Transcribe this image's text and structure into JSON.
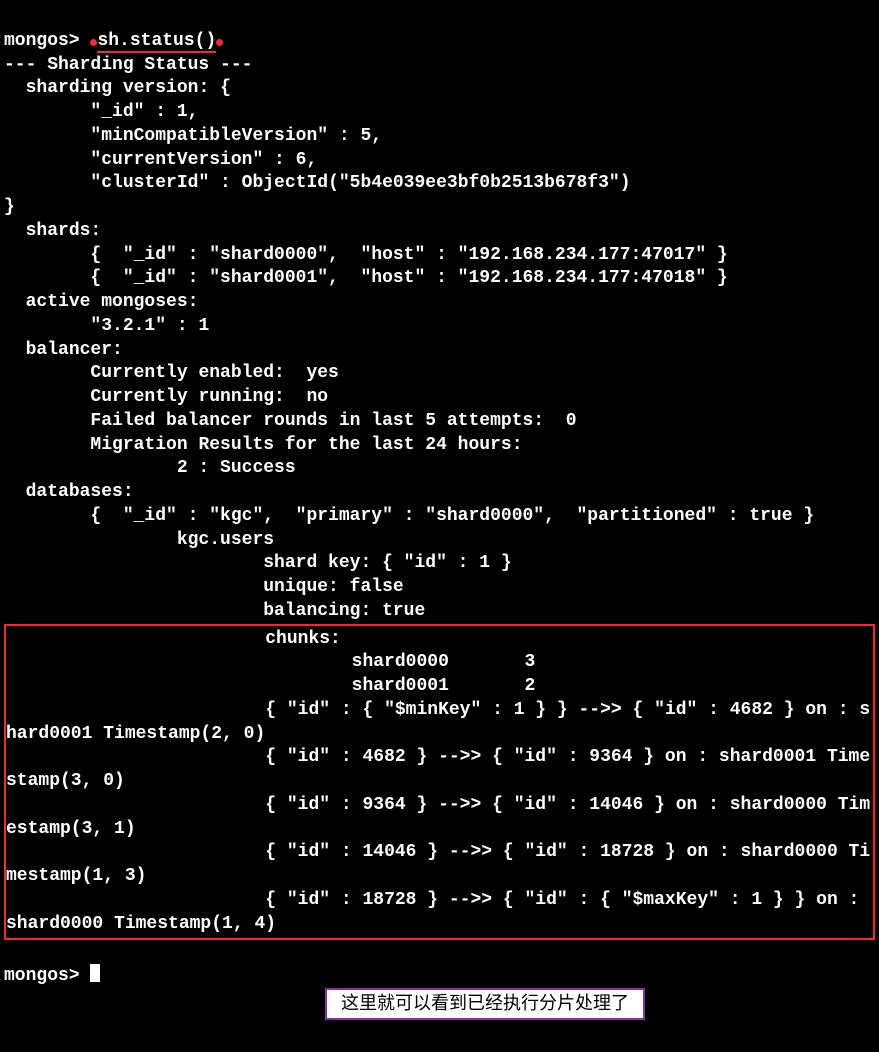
{
  "prompt": "mongos>",
  "command": "sh.status()",
  "header": "--- Sharding Status ---",
  "version_label": "sharding version:",
  "version_open": "{",
  "version_close": "}",
  "version_fields": {
    "id_key": "\"_id\"",
    "id_val": "1,",
    "min_key": "\"minCompatibleVersion\"",
    "min_val": "5,",
    "cur_key": "\"currentVersion\"",
    "cur_val": "6,",
    "cid_key": "\"clusterId\"",
    "cid_val": "ObjectId(\"5b4e039ee3bf0b2513b678f3\")"
  },
  "shards_label": "shards:",
  "shards": [
    "{  \"_id\" : \"shard0000\",  \"host\" : \"192.168.234.177:47017\" }",
    "{  \"_id\" : \"shard0001\",  \"host\" : \"192.168.234.177:47018\" }"
  ],
  "active_mongoses_label": "active mongoses:",
  "active_mongoses_line": "\"3.2.1\" : 1",
  "balancer_label": "balancer:",
  "balancer_lines": [
    "Currently enabled:  yes",
    "Currently running:  no",
    "Failed balancer rounds in last 5 attempts:  0",
    "Migration Results for the last 24 hours:",
    "                2 : Success"
  ],
  "databases_label": "databases:",
  "db_line": "{  \"_id\" : \"kgc\",  \"primary\" : \"shard0000\",  \"partitioned\" : true }",
  "coll_name": "kgc.users",
  "coll_lines": [
    "shard key: { \"id\" : 1 }",
    "unique: false",
    "balancing: true"
  ],
  "chunks_label": "chunks:",
  "chunks_summary": [
    "shard0000       3",
    "shard0001       2"
  ],
  "chunk_ranges": [
    "{ \"id\" : { \"$minKey\" : 1 } } -->> { \"id\" : 4682 } on : shard0001 Timestamp(2, 0)",
    "{ \"id\" : 4682 } -->> { \"id\" : 9364 } on : shard0001 Timestamp(3, 0)",
    "{ \"id\" : 9364 } -->> { \"id\" : 14046 } on : shard0000 Timestamp(3, 1)",
    "{ \"id\" : 14046 } -->> { \"id\" : 18728 } on : shard0000 Timestamp(1, 3)",
    "{ \"id\" : 18728 } -->> { \"id\" : { \"$maxKey\" : 1 } } on : shard0000 Timestamp(1, 4)"
  ],
  "annotation": "这里就可以看到已经执行分片处理了"
}
